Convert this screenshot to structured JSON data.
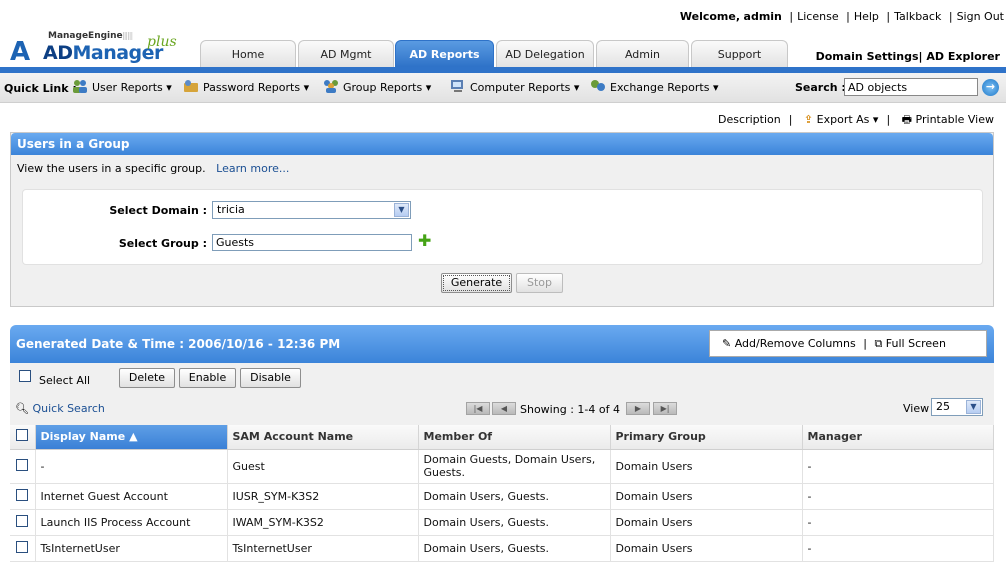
{
  "logo": {
    "vendor": "ManageEngine",
    "product_a": "AD",
    "product_b": "Manager",
    "plus": "plus"
  },
  "top_links": {
    "welcome": "Welcome,",
    "user": "admin",
    "items": [
      "License",
      "Help",
      "Talkback",
      "Sign Out"
    ]
  },
  "tabs": [
    "Home",
    "AD Mgmt",
    "AD Reports",
    "AD Delegation",
    "Admin",
    "Support"
  ],
  "active_tab": "AD Reports",
  "right_links": [
    "Domain Settings",
    "AD Explorer"
  ],
  "quick_link": {
    "label": "Quick Link :",
    "items": [
      "User Reports",
      "Password Reports",
      "Group Reports",
      "Computer Reports",
      "Exchange Reports"
    ]
  },
  "search": {
    "label": "Search :",
    "value": "AD objects"
  },
  "tool_links": {
    "description": "Description",
    "export": "Export As",
    "printable": "Printable View"
  },
  "report": {
    "title": "Users in a Group",
    "description": "View the users in a specific group.",
    "learn_more": "Learn more...",
    "domain_label": "Select Domain :",
    "domain_value": "tricia",
    "group_label": "Select Group :",
    "group_value": "Guests",
    "generate": "Generate",
    "stop": "Stop"
  },
  "results": {
    "generated": "Generated Date & Time : 2006/10/16 - 12:36 PM",
    "add_remove_columns": "Add/Remove Columns",
    "full_screen": "Full Screen",
    "select_all": "Select All",
    "delete": "Delete",
    "enable": "Enable",
    "disable": "Disable",
    "quick_search": "Quick Search",
    "showing": "Showing : 1-4 of 4",
    "view_label": "View",
    "view_value": "25",
    "columns": [
      "Display Name",
      "SAM Account Name",
      "Member Of",
      "Primary Group",
      "Manager"
    ],
    "rows": [
      [
        "-",
        "Guest",
        "Domain Guests, Domain Users, Guests.",
        "Domain Users",
        "-"
      ],
      [
        "Internet Guest Account",
        "IUSR_SYM-K3S2",
        "Domain Users, Guests.",
        "Domain Users",
        "-"
      ],
      [
        "Launch IIS Process Account",
        "IWAM_SYM-K3S2",
        "Domain Users, Guests.",
        "Domain Users",
        "-"
      ],
      [
        "TsInternetUser",
        "TsInternetUser",
        "Domain Users, Guests.",
        "Domain Users",
        "-"
      ]
    ]
  }
}
